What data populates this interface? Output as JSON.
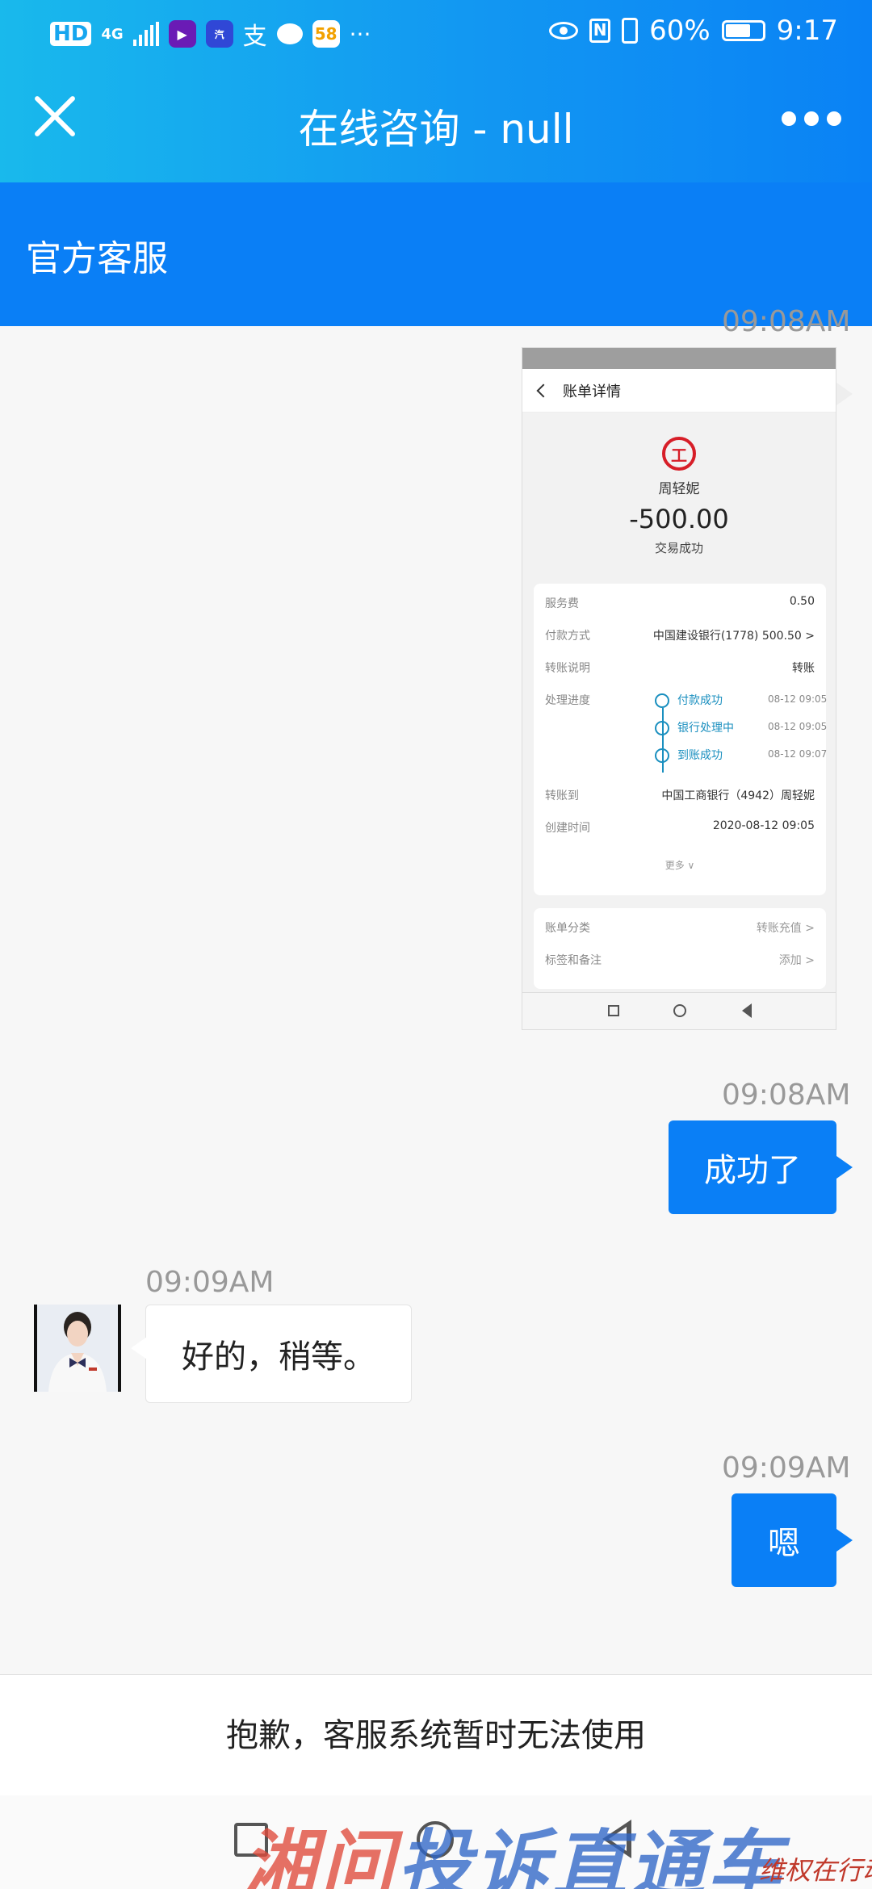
{
  "status_bar": {
    "network_badge": "HD",
    "network_type": "4G",
    "alipay_glyph": "支",
    "app_58": "58",
    "more_dots": "···",
    "battery_percent": "60%",
    "time": "9:17"
  },
  "header": {
    "title": "在线咨询 - null"
  },
  "agent": {
    "name": "官方客服"
  },
  "messages": {
    "m1": {
      "time": "09:08AM"
    },
    "m2": {
      "time": "09:08AM",
      "text": "成功了"
    },
    "m3": {
      "time": "09:09AM",
      "text": "好的，稍等。"
    },
    "m4": {
      "time": "09:09AM",
      "text": "嗯"
    }
  },
  "screenshot": {
    "title": "账单详情",
    "payee": "周轻妮",
    "amount": "-500.00",
    "status": "交易成功",
    "rows": [
      {
        "label": "服务费",
        "value": "0.50"
      },
      {
        "label": "付款方式",
        "value": "中国建设银行(1778) 500.50 >"
      },
      {
        "label": "转账说明",
        "value": "转账"
      },
      {
        "label": "处理进度",
        "value": ""
      },
      {
        "label": "转账到",
        "value": "中国工商银行（4942）周轻妮"
      },
      {
        "label": "创建时间",
        "value": "2020-08-12 09:05"
      }
    ],
    "steps": [
      {
        "label": "付款成功",
        "time": "08-12 09:05"
      },
      {
        "label": "银行处理中",
        "time": "08-12 09:05"
      },
      {
        "label": "到账成功",
        "time": "08-12 09:07"
      }
    ],
    "more": "更多 ∨",
    "category_label": "账单分类",
    "category_value": "转账充值 >",
    "tag_label": "标签和备注",
    "tag_value": "添加 >"
  },
  "notice": "抱歉，客服系统暂时无法使用",
  "watermark": {
    "part1": "湘问",
    "part2": "投诉直通车",
    "small": "维权在行动"
  },
  "colors": {
    "brand_blue": "#0a7ff6",
    "header_gradient_start": "#19b9ec",
    "icbc_red": "#d71e28",
    "progress_teal": "#1a8fbf"
  }
}
